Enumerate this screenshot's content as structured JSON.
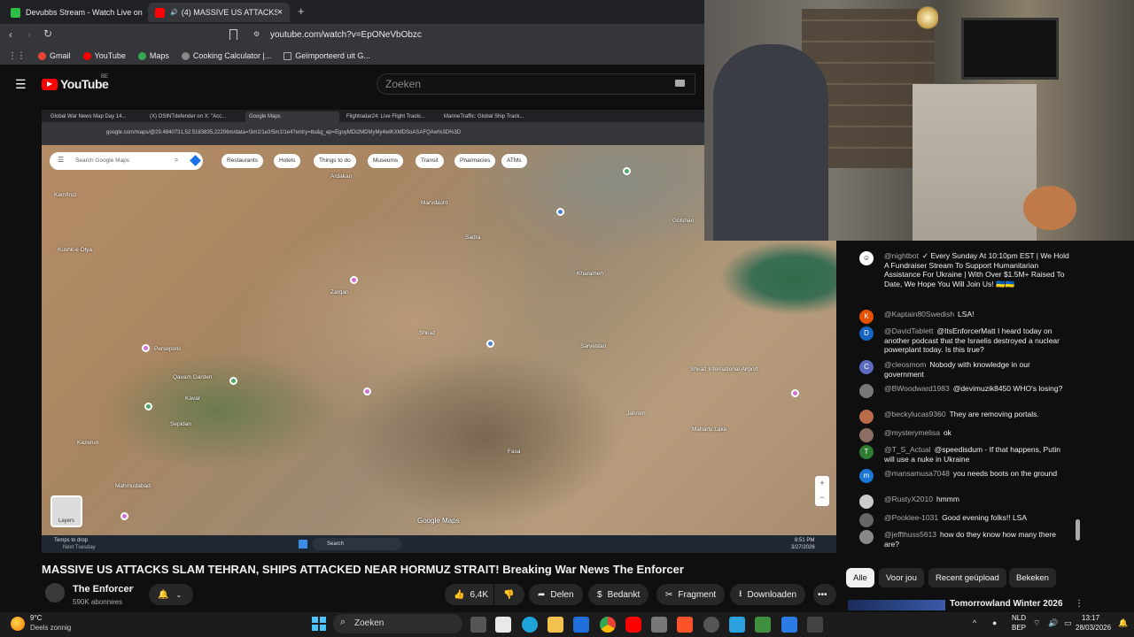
{
  "browser": {
    "tabs": [
      {
        "label": "Devubbs Stream - Watch Live on",
        "color": "#2dbe45"
      },
      {
        "label": "(4) MASSIVE US ATTACKS SLA",
        "color": "#ff0000"
      }
    ],
    "new_tab": "+",
    "close": "×",
    "url": "youtube.com/watch?v=EpONeVbObzc",
    "bookmarks": [
      {
        "label": "Gmail",
        "color": "#ea4335"
      },
      {
        "label": "YouTube",
        "color": "#ff0000"
      },
      {
        "label": "Maps",
        "color": "#34a853"
      },
      {
        "label": "Cooking Calculator |...",
        "color": "#888888"
      },
      {
        "label": "Geïmporteerd uit G...",
        "color": "#aaaaaa"
      }
    ]
  },
  "youtube": {
    "logo": "YouTube",
    "region": "BE",
    "search_placeholder": "Zoeken"
  },
  "video": {
    "inner_tabs": [
      "Global War News Map Day 14...",
      "(X) OSINTdefender on X: \"Acc...",
      "Google Maps",
      "Flightradar24: Live Flight Tracki...",
      "MarineTraffic: Global Ship Track..."
    ],
    "inner_url": "google.com/maps/@29.4840731,52.5183835,22206m/data=!3m1!1e3!5m1!1e4?entry=ttu&g_ep=EgoyMDI2MDMyMy4wIKXMDSoASAFQAw%3D%3D",
    "map_search_placeholder": "Search Google Maps",
    "map_chips": [
      "Restaurants",
      "Hotels",
      "Things to do",
      "Museums",
      "Transit",
      "Pharmacies",
      "ATMs"
    ],
    "places": [
      "Kamfiruz",
      "Kushk-e Olya",
      "Ardakan",
      "Marvdasht",
      "Shiraz",
      "Sadra",
      "Zarqan",
      "Kharameh",
      "Kavar",
      "Sarvestan",
      "Sepidan",
      "Maharlu Lake",
      "Shiraz International Airport",
      "Golshan",
      "Jahrom",
      "Fasa",
      "Kazerun",
      "Mahmudabad",
      "Qavam Garden",
      "Persepolis"
    ],
    "map_watermark": "Google Maps",
    "layers_label": "Layers",
    "weather_title": "Temps to drop",
    "weather_sub": "Next Tuesday",
    "inner_taskbar_search": "Search",
    "inner_time": "8:51 PM",
    "inner_date": "3/27/2026"
  },
  "chat": {
    "messages": [
      {
        "author": "@nightbot",
        "text": "✓ Every Sunday At 10:10pm EST | We Hold A Fundraiser Stream To Support Humanitarian Assistance For Ukraine | With Over $1.5M+ Raised To Date, We Hope You Will Join Us! 🇺🇦🇺🇦",
        "avatar": "",
        "color": "#ffffff"
      },
      {
        "author": "@Kaptain80Swedish",
        "text": "LSA!",
        "avatar": "K",
        "color": "#e65100"
      },
      {
        "author": "@DavidTablett",
        "text": "@ItsEnforcerMatt I heard today on another podcast that the Israelis destroyed a nuclear powerplant today. Is this true?",
        "avatar": "D",
        "color": "#1565c0"
      },
      {
        "author": "@cleosmom",
        "text": "Nobody with knowledge in our government",
        "avatar": "C",
        "color": "#5c6bc0"
      },
      {
        "author": "@BWoodward1983",
        "text": "@devimuzik8450 WHO's losing?",
        "avatar": "",
        "color": "#777777"
      },
      {
        "author": "@beckylucas9360",
        "text": "They are removing portals.",
        "avatar": "",
        "color": "#b96b4a"
      },
      {
        "author": "@mysterymelisa",
        "text": "ok",
        "avatar": "",
        "color": "#8d6e63"
      },
      {
        "author": "@T_S_Actual",
        "text": "@speedisdum - If that happens, Putin will use a nuke in Ukraine",
        "avatar": "T",
        "color": "#2e7d32"
      },
      {
        "author": "@mansamusa7048",
        "text": "you needs boots on the ground",
        "avatar": "m",
        "color": "#1976d2"
      },
      {
        "author": "@RustyX2010",
        "text": "hmmm",
        "avatar": "",
        "color": "#cccccc"
      },
      {
        "author": "@Pooklee-1031",
        "text": "Good evening folks!! LSA",
        "avatar": "",
        "color": "#666666"
      },
      {
        "author": "@jeffthuss5613",
        "text": "how do they know how many there are?",
        "avatar": "",
        "color": "#888888"
      }
    ]
  },
  "watch": {
    "title": "MASSIVE US ATTACKS SLAM TEHRAN, SHIPS ATTACKED NEAR HORMUZ STRAIT! Breaking War News The Enforcer",
    "channel": "The Enforcer",
    "subscribers": "590K abonnees",
    "likes": "6,4K",
    "share": "Delen",
    "thanks": "Bedankt",
    "clip": "Fragment",
    "download": "Downloaden",
    "more": "•••",
    "filter_chips": [
      "Alle",
      "Voor jou",
      "Recent geüpload",
      "Bekeken"
    ],
    "recommended_title": "Tomorrowland Winter 2026"
  },
  "taskbar": {
    "temp": "9°C",
    "weather": "Deels zonnig",
    "search": "Zoeken",
    "lang1": "NLD",
    "lang2": "BEP",
    "time": "13:17",
    "date": "28/03/2026"
  }
}
